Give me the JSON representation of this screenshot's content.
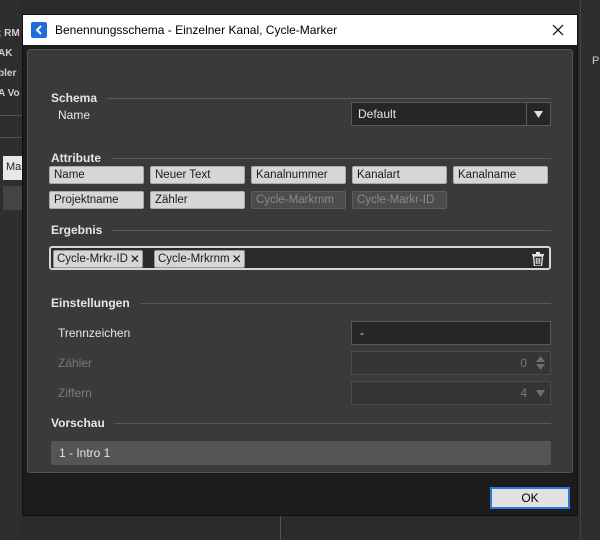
{
  "background": {
    "left_fragments": [
      "; RM",
      "AK",
      "bler",
      "A Vo"
    ],
    "left_input_fragment": "Ma",
    "right_fragment": "P"
  },
  "window": {
    "title": "Benennungsschema - Einzelner Kanal, Cycle-Marker",
    "close_icon": "close-icon",
    "app_icon": "app-logo-icon"
  },
  "schema": {
    "header": "Schema",
    "name_label": "Name",
    "name_value": "Default"
  },
  "attribute": {
    "header": "Attribute",
    "chips": [
      {
        "label": "Name",
        "enabled": true
      },
      {
        "label": "Neuer Text",
        "enabled": true
      },
      {
        "label": "Kanalnummer",
        "enabled": true
      },
      {
        "label": "Kanalart",
        "enabled": true
      },
      {
        "label": "Kanalname",
        "enabled": true
      },
      {
        "label": "Projektname",
        "enabled": true
      },
      {
        "label": "Zähler",
        "enabled": true
      },
      {
        "label": "Cycle-Markrnm",
        "enabled": false
      },
      {
        "label": "Cycle-Markr-ID",
        "enabled": false
      }
    ]
  },
  "ergebnis": {
    "header": "Ergebnis",
    "tokens": [
      "Cycle-Mrkr-ID",
      "Cycle-Mrkrnm"
    ],
    "remove_glyph": "✕"
  },
  "einstellungen": {
    "header": "Einstellungen",
    "trennzeichen_label": "Trennzeichen",
    "trennzeichen_value": "-",
    "zaehler_label": "Zähler",
    "zaehler_value": "0",
    "ziffern_label": "Ziffern",
    "ziffern_value": "4"
  },
  "vorschau": {
    "header": "Vorschau",
    "value": "1 - Intro 1"
  },
  "footer": {
    "ok_label": "OK"
  },
  "colors": {
    "accent": "#2a7ad9",
    "panel": "#3a3a3a",
    "chip": "#d6d6d6"
  }
}
